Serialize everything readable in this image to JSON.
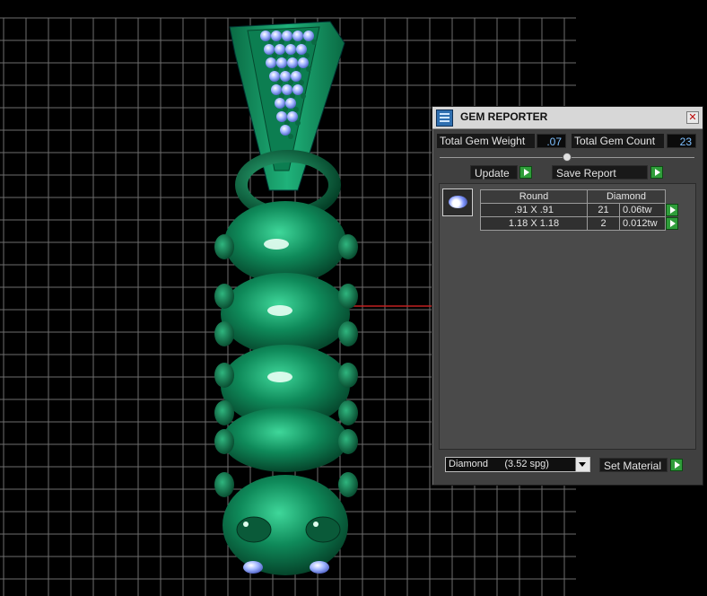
{
  "scene": {
    "background": "#000000",
    "grid_color": "#6e6e6e",
    "model_color": "#0e8a5a",
    "gem_color": "#9fb4ff",
    "axis_color": "#c02020"
  },
  "panel": {
    "title": "GEM REPORTER",
    "close_icon": "close-icon",
    "total_weight_label": "Total Gem Weight",
    "total_weight_value": ".07",
    "total_count_label": "Total Gem Count",
    "total_count_value": "23",
    "update_label": "Update",
    "save_report_label": "Save Report",
    "table": {
      "cut": "Round",
      "material": "Diamond",
      "rows": [
        {
          "size": ".91 X .91",
          "count": "21",
          "weight": "0.06tw"
        },
        {
          "size": "1.18 X 1.18",
          "count": "2",
          "weight": "0.012tw"
        }
      ]
    },
    "material_select": "Diamond      (3.52 spg)",
    "set_material_label": "Set Material",
    "accent": "#2f9d3a"
  }
}
